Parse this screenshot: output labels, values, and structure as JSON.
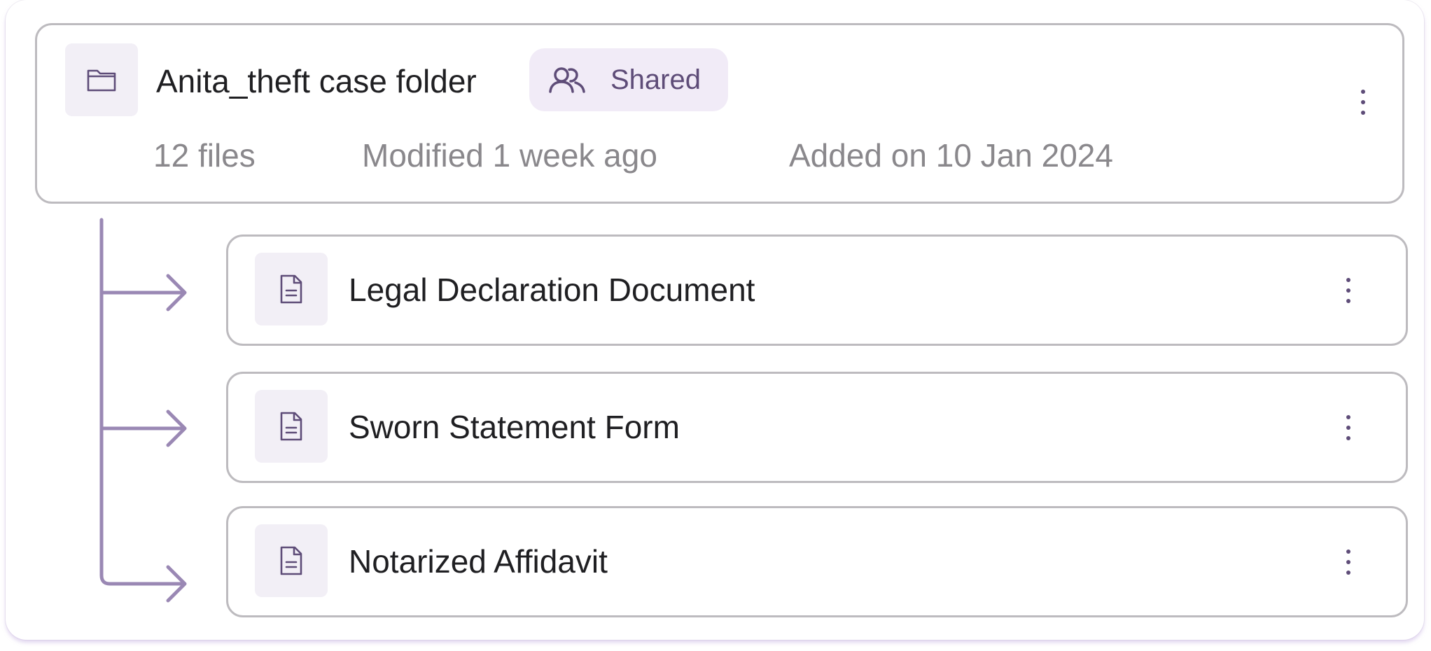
{
  "folder": {
    "title": "Anita_theft case folder",
    "shared_label": "Shared",
    "file_count": "12 files",
    "modified": "Modified 1 week ago",
    "added": "Added on 10 Jan 2024",
    "icon": "folder-icon"
  },
  "files": [
    {
      "name": "Legal Declaration Document",
      "icon": "document-icon"
    },
    {
      "name": "Sworn Statement Form",
      "icon": "document-icon"
    },
    {
      "name": "Notarized Affidavit",
      "icon": "document-icon"
    }
  ],
  "colors": {
    "accent": "#5e4c78",
    "tree_line": "#9a88b4",
    "badge_bg": "#f1ebf7",
    "icon_bg": "#f2eff6",
    "border": "#bdbbbf",
    "text_primary": "#1f1f22",
    "text_secondary": "#8a888c"
  }
}
